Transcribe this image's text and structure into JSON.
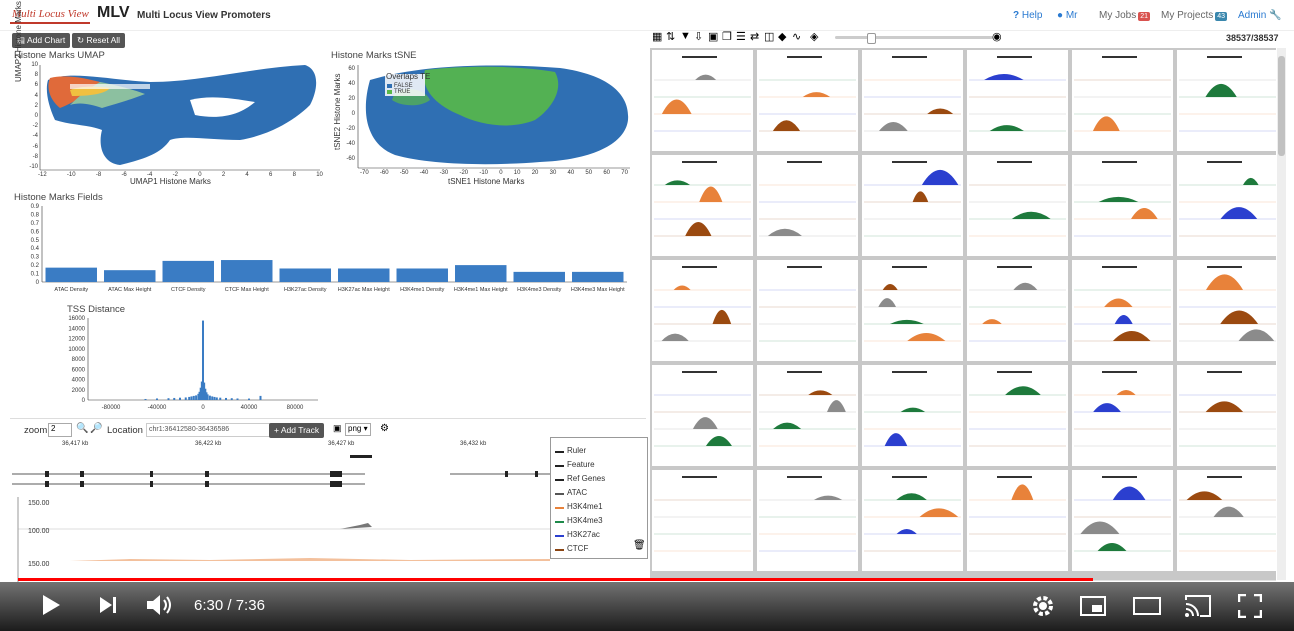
{
  "header": {
    "logo_text": "Multi Locus View",
    "app_title": "MLV",
    "app_subtitle": "Multi Locus View Promoters",
    "help": "Help",
    "user": "Mr",
    "my_jobs": "My Jobs",
    "my_jobs_count": "21",
    "my_projects": "My Projects",
    "my_projects_count": "43",
    "admin": "Admin"
  },
  "toolbar": {
    "add_chart": "Add Chart",
    "reset_all": "Reset All"
  },
  "umap": {
    "title": "Histone Marks UMAP",
    "xlabel": "UMAP1 Histone Marks",
    "ylabel": "UMAP2 Histone Marks",
    "xticks": [
      "-12",
      "-10",
      "-8",
      "-6",
      "-4",
      "-2",
      "0",
      "2",
      "4",
      "6",
      "8",
      "10"
    ],
    "yticks": [
      "10",
      "8",
      "6",
      "4",
      "2",
      "0",
      "-2",
      "-4",
      "-6",
      "-8",
      "-10"
    ]
  },
  "tsne": {
    "title": "Histone Marks tSNE",
    "xlabel": "tSNE1 Histone Marks",
    "ylabel": "tSNE2 Histone Marks",
    "legend_title": "Overlaps TE",
    "legend_items": [
      "FALSE",
      "TRUE"
    ],
    "xticks": [
      "-70",
      "-60",
      "-50",
      "-40",
      "-30",
      "-20",
      "-10",
      "0",
      "10",
      "20",
      "30",
      "40",
      "50",
      "60",
      "70"
    ],
    "yticks": [
      "60",
      "40",
      "20",
      "0",
      "-20",
      "-40",
      "-60"
    ]
  },
  "fields_chart": {
    "title": "Histone Marks Fields"
  },
  "tss_chart": {
    "title": "TSS Distance"
  },
  "chart_data": [
    {
      "type": "bar",
      "title": "Histone Marks Fields",
      "categories": [
        "ATAC Density",
        "ATAC Max Height",
        "CTCF Density",
        "CTCF Max Height",
        "H3K27ac Density",
        "H3K27ac Max Height",
        "H3K4me1 Density",
        "H3K4me1 Max Height",
        "H3K4me3 Density",
        "H3K4me3 Max Height"
      ],
      "values": [
        0.17,
        0.14,
        0.25,
        0.26,
        0.16,
        0.16,
        0.16,
        0.2,
        0.12,
        0.12
      ],
      "ylim": [
        0,
        0.9
      ],
      "yticks": [
        "0.9",
        "0.8",
        "0.7",
        "0.6",
        "0.5",
        "0.4",
        "0.3",
        "0.2",
        "0.1",
        "0"
      ]
    },
    {
      "type": "bar",
      "title": "TSS Distance",
      "xticks": [
        "-80000",
        "-40000",
        "0",
        "40000",
        "80000"
      ],
      "yticks": [
        "16000",
        "14000",
        "12000",
        "10000",
        "8000",
        "6000",
        "4000",
        "2000",
        "0"
      ],
      "ylim": [
        0,
        16000
      ],
      "x": [
        -50000,
        -40000,
        -30000,
        -25000,
        -20000,
        -15000,
        -12000,
        -10000,
        -8000,
        -6000,
        -4000,
        -3000,
        -2000,
        -1000,
        0,
        1000,
        2000,
        3000,
        4000,
        6000,
        8000,
        10000,
        12000,
        15000,
        20000,
        25000,
        30000,
        40000,
        50000
      ],
      "values": [
        200,
        300,
        350,
        400,
        450,
        500,
        600,
        700,
        800,
        900,
        1200,
        1600,
        2400,
        3600,
        15500,
        3400,
        2200,
        1500,
        1100,
        850,
        700,
        600,
        500,
        450,
        400,
        350,
        300,
        280,
        800
      ]
    }
  ],
  "browser": {
    "zoom_label": "zoom",
    "zoom_value": "2",
    "location_label": "Location",
    "location_value": "chr1:36412580-36436586",
    "add_track": "Add Track",
    "format_value": "png",
    "ruler_ticks": [
      "36,417 kb",
      "36,422 kb",
      "36,427 kb",
      "36,432 kb"
    ],
    "track_values": [
      "150.00",
      "100.00",
      "150.00"
    ],
    "legend": [
      "Ruler",
      "Feature",
      "Ref Genes",
      "ATAC",
      "H3K4me1",
      "H3K4me3",
      "H3K27ac",
      "CTCF"
    ],
    "legend_colors": [
      "#222222",
      "#222222",
      "#222222",
      "#555555",
      "#e8823a",
      "#1e8a4a",
      "#2b3fcf",
      "#8b4513"
    ]
  },
  "grid": {
    "count": "38537/38537"
  },
  "video": {
    "current_time": "6:30",
    "separator": "/",
    "duration": "7:36",
    "progress_fraction": 0.855
  }
}
